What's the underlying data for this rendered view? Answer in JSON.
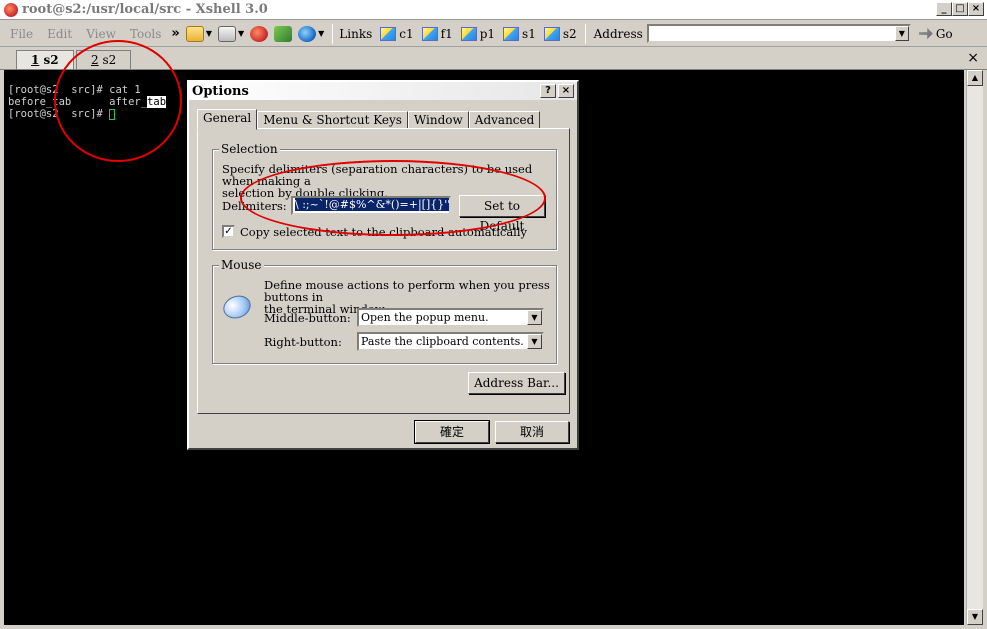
{
  "window": {
    "title": "root@s2:/usr/local/src - Xshell 3.0",
    "buttons": [
      "_",
      "□",
      "×"
    ]
  },
  "menubar": {
    "menus": [
      {
        "label": "File",
        "accel": "F"
      },
      {
        "label": "Edit",
        "accel": "E"
      },
      {
        "label": "View",
        "accel": "V"
      },
      {
        "label": "Tools",
        "accel": "T"
      }
    ],
    "chevron": "»",
    "links_label": "Links",
    "links": [
      "c1",
      "f1",
      "p1",
      "s1",
      "s2"
    ],
    "address_label": "Address",
    "address_value": "",
    "go_label": "Go"
  },
  "tabs": [
    {
      "num": "1",
      "label": "s2",
      "active": true
    },
    {
      "num": "2",
      "label": "s2",
      "active": false
    }
  ],
  "tab_close": "×",
  "terminal": {
    "lines": [
      {
        "text": "[root@s2  src]# cat 1"
      },
      {
        "before": "before_tab      after_",
        "highlight": "tab"
      },
      {
        "text": "[root@s2  src]# "
      }
    ]
  },
  "dialog": {
    "title": "Options",
    "help_btn": "?",
    "close_btn": "×",
    "tabs": [
      "General",
      "Menu & Shortcut Keys",
      "Window",
      "Advanced"
    ],
    "selection": {
      "label": "Selection",
      "description_line1": "Specify delimiters (separation characters) to be used when making a",
      "description_line2": "selection by double clicking.",
      "delimiters_label": "Delimiters:",
      "delimiters_value": "\\ :;~`!@#$%^&*()=+|[]{}'\",<>?",
      "set_default_btn": "Set to Default",
      "copy_checkbox_label": "Copy selected text to the clipboard automatically",
      "copy_checked": true
    },
    "mouse": {
      "label": "Mouse",
      "description_line1": "Define mouse actions to perform when you press buttons in",
      "description_line2": "the terminal window.",
      "middle_label": "Middle-button:",
      "middle_value": "Open the popup menu.",
      "right_label": "Right-button:",
      "right_value": "Paste the clipboard contents."
    },
    "address_bar_btn": "Address Bar...",
    "ok_btn": "確定",
    "cancel_btn": "取消"
  },
  "colors": {
    "annotation": "#e10000",
    "terminal_bg": "#000000",
    "cursor": "#22c55e"
  }
}
